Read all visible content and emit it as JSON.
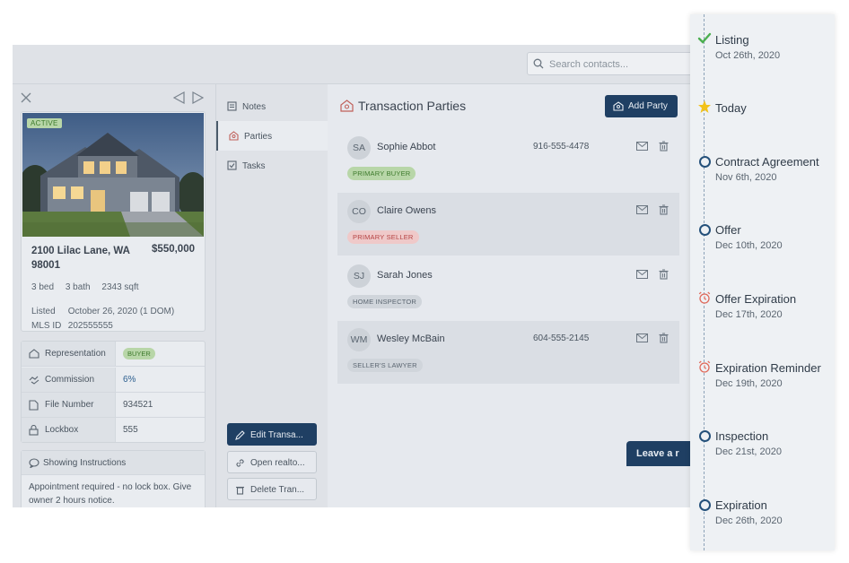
{
  "search": {
    "placeholder": "Search contacts..."
  },
  "listing": {
    "status": "ACTIVE",
    "address": "2100 Lilac Lane, WA 98001",
    "price": "$550,000",
    "beds": "3 bed",
    "baths": "3 bath",
    "sqft": "2343 sqft",
    "listed_label": "Listed",
    "listed_value": "October 26, 2020 (1 DOM)",
    "mls_label": "MLS ID",
    "mls_value": "202555555"
  },
  "details": [
    {
      "label": "Representation",
      "value": "BUYER",
      "icon": "house-icon"
    },
    {
      "label": "Commission",
      "value": "6%",
      "icon": "handshake-icon"
    },
    {
      "label": "File Number",
      "value": "934521",
      "icon": "file-icon"
    },
    {
      "label": "Lockbox",
      "value": "555",
      "icon": "lock-icon"
    }
  ],
  "showing": {
    "title": "Showing Instructions",
    "text": "Appointment required - no lock box. Give owner 2 hours notice."
  },
  "nav": [
    {
      "label": "Notes",
      "icon": "notes-icon"
    },
    {
      "label": "Parties",
      "icon": "parties-icon"
    },
    {
      "label": "Tasks",
      "icon": "tasks-icon"
    }
  ],
  "actions": {
    "edit": "Edit Transa...",
    "open": "Open realto...",
    "delete": "Delete Tran..."
  },
  "parties": {
    "title": "Transaction Parties",
    "add_label": "Add Party",
    "list": [
      {
        "initials": "SA",
        "name": "Sophie Abbot",
        "phone": "916-555-4478",
        "role": "PRIMARY BUYER"
      },
      {
        "initials": "CO",
        "name": "Claire Owens",
        "phone": "",
        "role": "PRIMARY SELLER"
      },
      {
        "initials": "SJ",
        "name": "Sarah Jones",
        "phone": "",
        "role": "HOME INSPECTOR"
      },
      {
        "initials": "WM",
        "name": "Wesley McBain",
        "phone": "604-555-2145",
        "role": "SELLER'S LAWYER"
      }
    ]
  },
  "leave_label": "Leave a r",
  "timeline": [
    {
      "title": "Listing",
      "date": "Oct 26th, 2020",
      "marker": "check-icon"
    },
    {
      "title": "Today",
      "date": "",
      "marker": "star-icon"
    },
    {
      "title": "Contract Agreement",
      "date": "Nov 6th, 2020",
      "marker": "circle-icon"
    },
    {
      "title": "Offer",
      "date": "Dec 10th, 2020",
      "marker": "circle-icon"
    },
    {
      "title": "Offer Expiration",
      "date": "Dec 17th, 2020",
      "marker": "alarm-icon"
    },
    {
      "title": "Expiration Reminder",
      "date": "Dec 19th, 2020",
      "marker": "alarm-icon"
    },
    {
      "title": "Inspection",
      "date": "Dec 21st, 2020",
      "marker": "circle-icon"
    },
    {
      "title": "Expiration",
      "date": "Dec 26th, 2020",
      "marker": "circle-icon"
    }
  ],
  "colors": {
    "navy": "#1f3f63",
    "green_badge": "#b8d6a8",
    "red_badge": "#efc9c9",
    "check": "#4caf50",
    "star": "#f2c21a",
    "alarm": "#e0695a"
  }
}
